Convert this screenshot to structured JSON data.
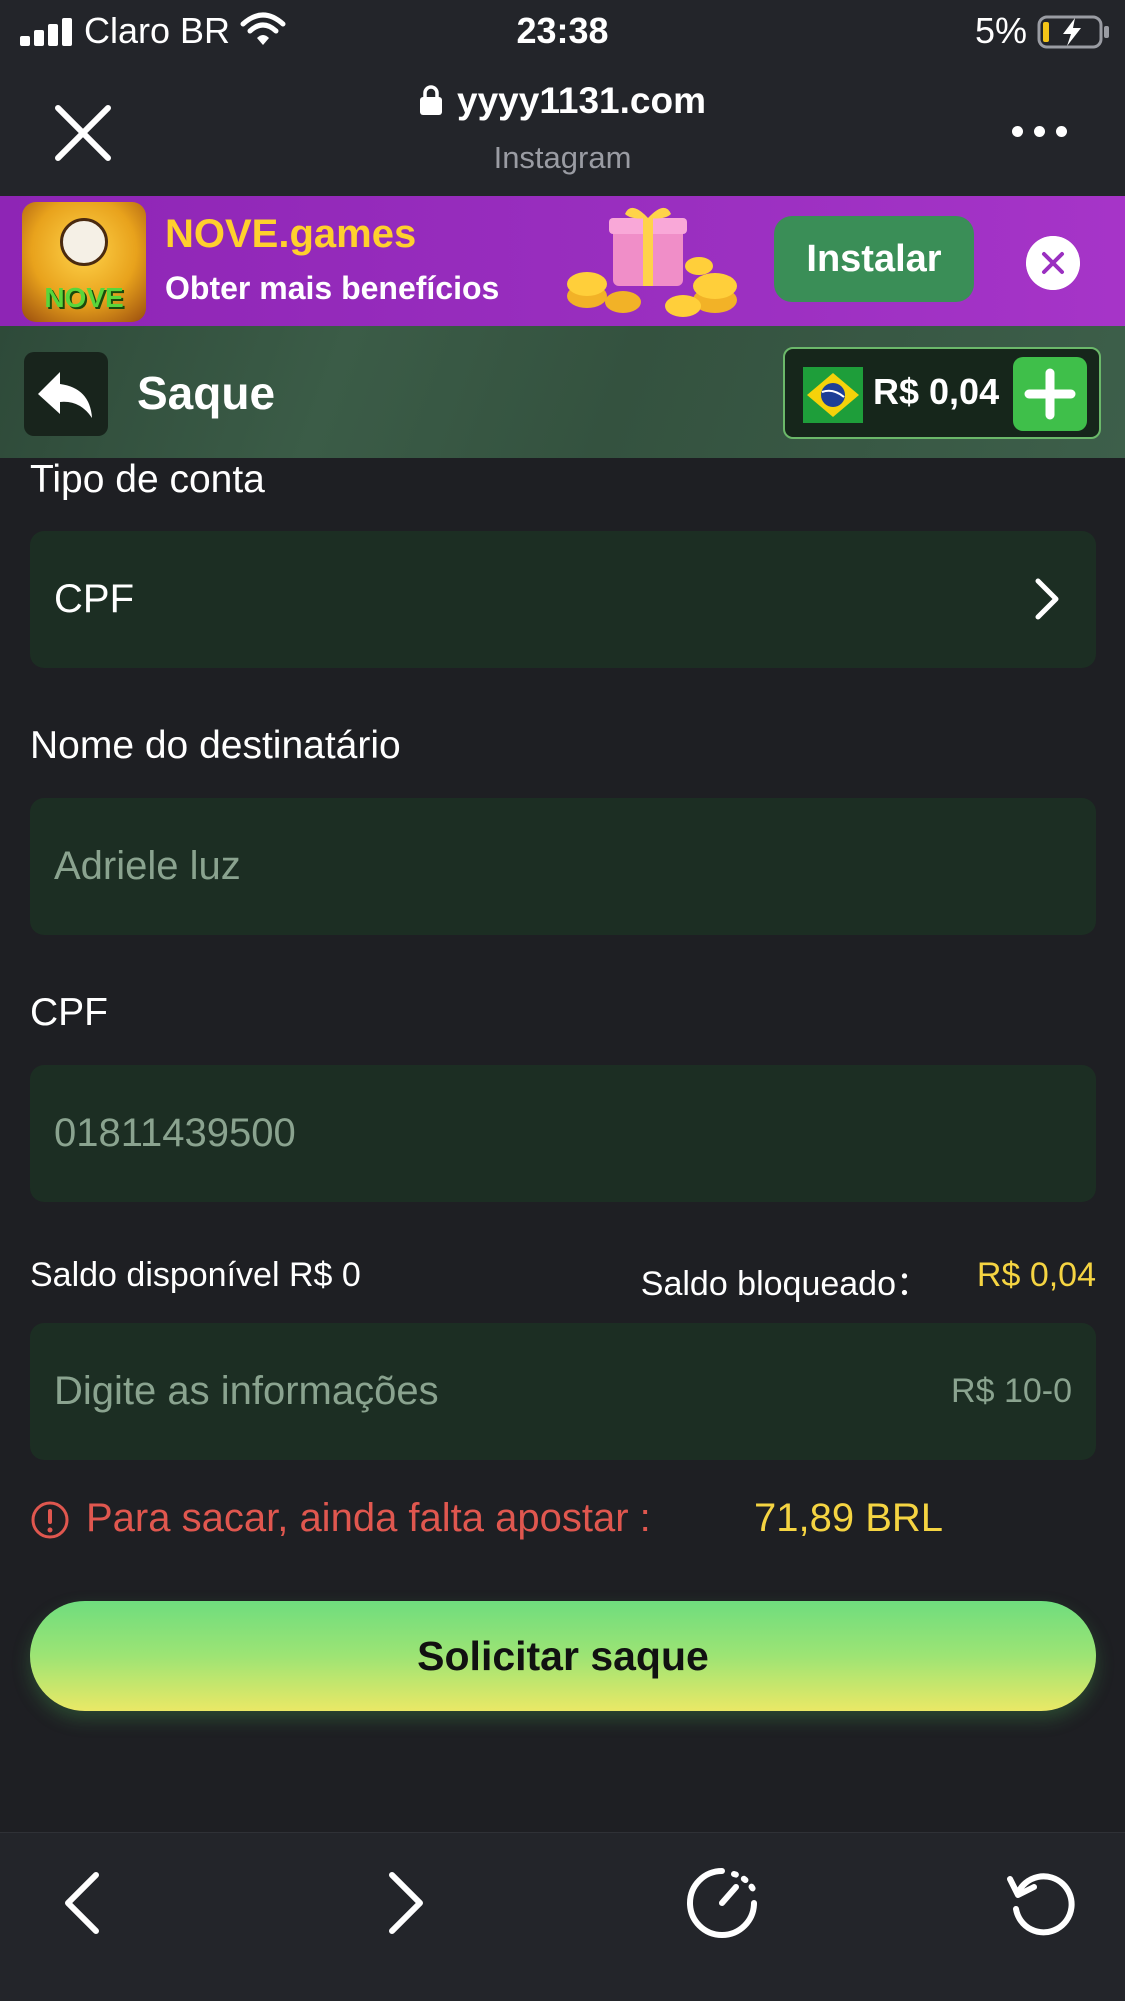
{
  "status_bar": {
    "carrier": "Claro BR",
    "time": "23:38",
    "battery_percent": "5%"
  },
  "browser": {
    "url": "yyyy1131.com",
    "source": "Instagram"
  },
  "banner": {
    "logo_text": "NOVE",
    "title": "NOVE.games",
    "subtitle": "Obter mais benefícios",
    "install_label": "Instalar"
  },
  "header": {
    "title": "Saque",
    "balance": "R$ 0,04"
  },
  "form": {
    "account_type_label": "Tipo de conta",
    "account_type_value": "CPF",
    "recipient_label": "Nome do destinatário",
    "recipient_value": "Adriele luz",
    "cpf_label": "CPF",
    "cpf_value": "01811439500",
    "available_balance": "Saldo disponível R$ 0",
    "blocked_label": "Saldo bloqueado：",
    "blocked_value": "R$ 0,04",
    "amount_placeholder": "Digite as informações",
    "amount_range": "R$ 10-0",
    "warning_text": "Para sacar, ainda falta apostar :",
    "warning_amount": "71,89 BRL",
    "submit_label": "Solicitar saque"
  },
  "colors": {
    "background": "#1e1f23",
    "field_bg": "#1c2e23",
    "accent_yellow": "#f5d442",
    "warning_red": "#e0574f",
    "banner_purple": "#9a2fc0",
    "install_green": "#3a8e57"
  },
  "toolbar": {
    "icons": [
      "back-icon",
      "forward-icon",
      "timer-icon",
      "reload-icon"
    ]
  }
}
